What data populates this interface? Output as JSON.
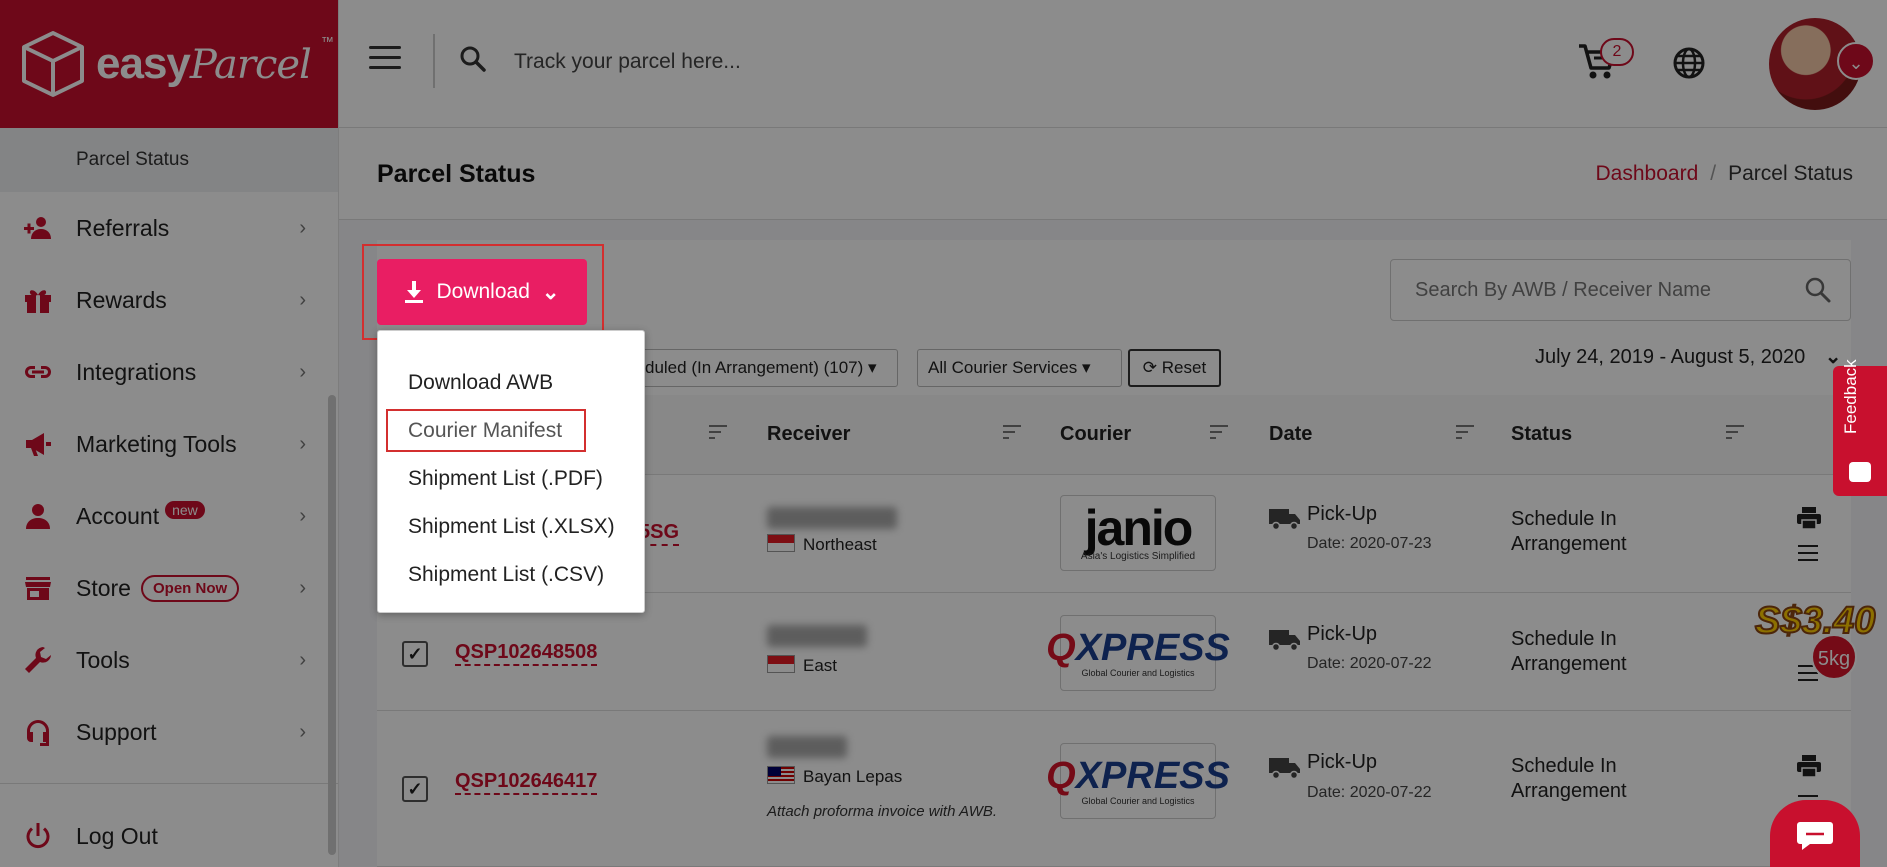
{
  "brand": {
    "name": "easy",
    "script": "Parcel",
    "tm": "™"
  },
  "sidebar": {
    "active_sub": "Parcel Status",
    "items": [
      {
        "label": "Referrals",
        "icon": "referral-icon"
      },
      {
        "label": "Rewards",
        "icon": "gift-icon"
      },
      {
        "label": "Integrations",
        "icon": "link-icon"
      },
      {
        "label": "Marketing Tools",
        "icon": "megaphone-icon"
      },
      {
        "label": "Account",
        "icon": "user-icon",
        "badge": "new"
      },
      {
        "label": "Store",
        "icon": "store-icon",
        "badge": "Open Now"
      },
      {
        "label": "Tools",
        "icon": "wrench-icon"
      },
      {
        "label": "Support",
        "icon": "headset-icon"
      }
    ],
    "logout": "Log Out"
  },
  "topbar": {
    "search_placeholder": "Track your parcel here...",
    "cart_count": "2"
  },
  "header": {
    "title": "Parcel Status",
    "breadcrumb": {
      "link": "Dashboard",
      "separator": "/",
      "current": "Parcel Status"
    }
  },
  "toolbar": {
    "download_label": "Download",
    "search_placeholder": "Search By AWB / Receiver Name",
    "filter_status": "duled (In Arrangement) (107)",
    "filter_courier": "All Courier Services",
    "reset_label": "Reset",
    "date_range": "July 24, 2019 - August 5, 2020"
  },
  "download_menu": {
    "items": [
      "Download AWB",
      "Courier Manifest",
      "Shipment List (.PDF)",
      "Shipment List (.XLSX)",
      "Shipment List (.CSV)"
    ],
    "highlighted": "Courier Manifest"
  },
  "table": {
    "columns": [
      "Receiver",
      "Courier",
      "Date",
      "Status"
    ],
    "rows": [
      {
        "awb": "5SG",
        "checked": false,
        "region": "Northeast",
        "flag": "SG",
        "courier": "janio",
        "courier_tagline": "Asia's Logistics Simplified",
        "pickup_label": "Pick-Up",
        "date": "Date: 2020-07-23",
        "status": "Schedule In Arrangement"
      },
      {
        "awb": "QSP102648508",
        "checked": true,
        "region": "East",
        "flag": "SG",
        "courier": "QXPRESS",
        "courier_tagline": "Global Courier and Logistics",
        "pickup_label": "Pick-Up",
        "date": "Date: 2020-07-22",
        "status": "Schedule In Arrangement"
      },
      {
        "awb": "QSP102646417",
        "checked": true,
        "region": "Bayan Lepas",
        "flag": "MY",
        "note": "Attach proforma invoice with AWB.",
        "courier": "QXPRESS",
        "courier_tagline": "Global Courier and Logistics",
        "pickup_label": "Pick-Up",
        "date": "Date: 2020-07-22",
        "status": "Schedule In Arrangement"
      }
    ]
  },
  "floating": {
    "feedback": "Feedback",
    "promo_price": "S$3.40",
    "promo_weight": "5kg"
  },
  "colors": {
    "brand": "#c8102e",
    "accent": "#e91e63",
    "highlight": "#d32f2f"
  }
}
